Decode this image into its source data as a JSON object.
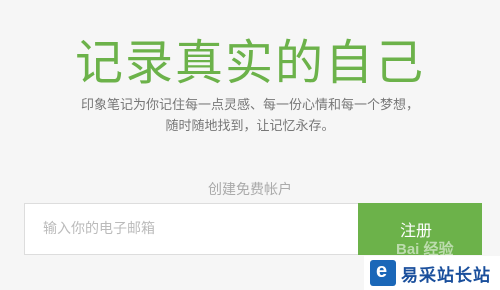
{
  "hero": {
    "title": "记录真实的自己",
    "tagline_line1": "印象笔记为你记住每一点灵感、每一份心情和每一个梦想，",
    "tagline_line2": "随时随地找到，让记忆永存。"
  },
  "signup": {
    "section_label": "创建免费帐户",
    "email_placeholder": "输入你的电子邮箱",
    "submit_label": "注册"
  },
  "watermark": {
    "baidu_text": "Bai 经验",
    "site_name": "易采站长站",
    "logo_icon": "e-logo-icon"
  },
  "colors": {
    "accent": "#6cb24a",
    "watermark_blue": "#1a67b8"
  }
}
